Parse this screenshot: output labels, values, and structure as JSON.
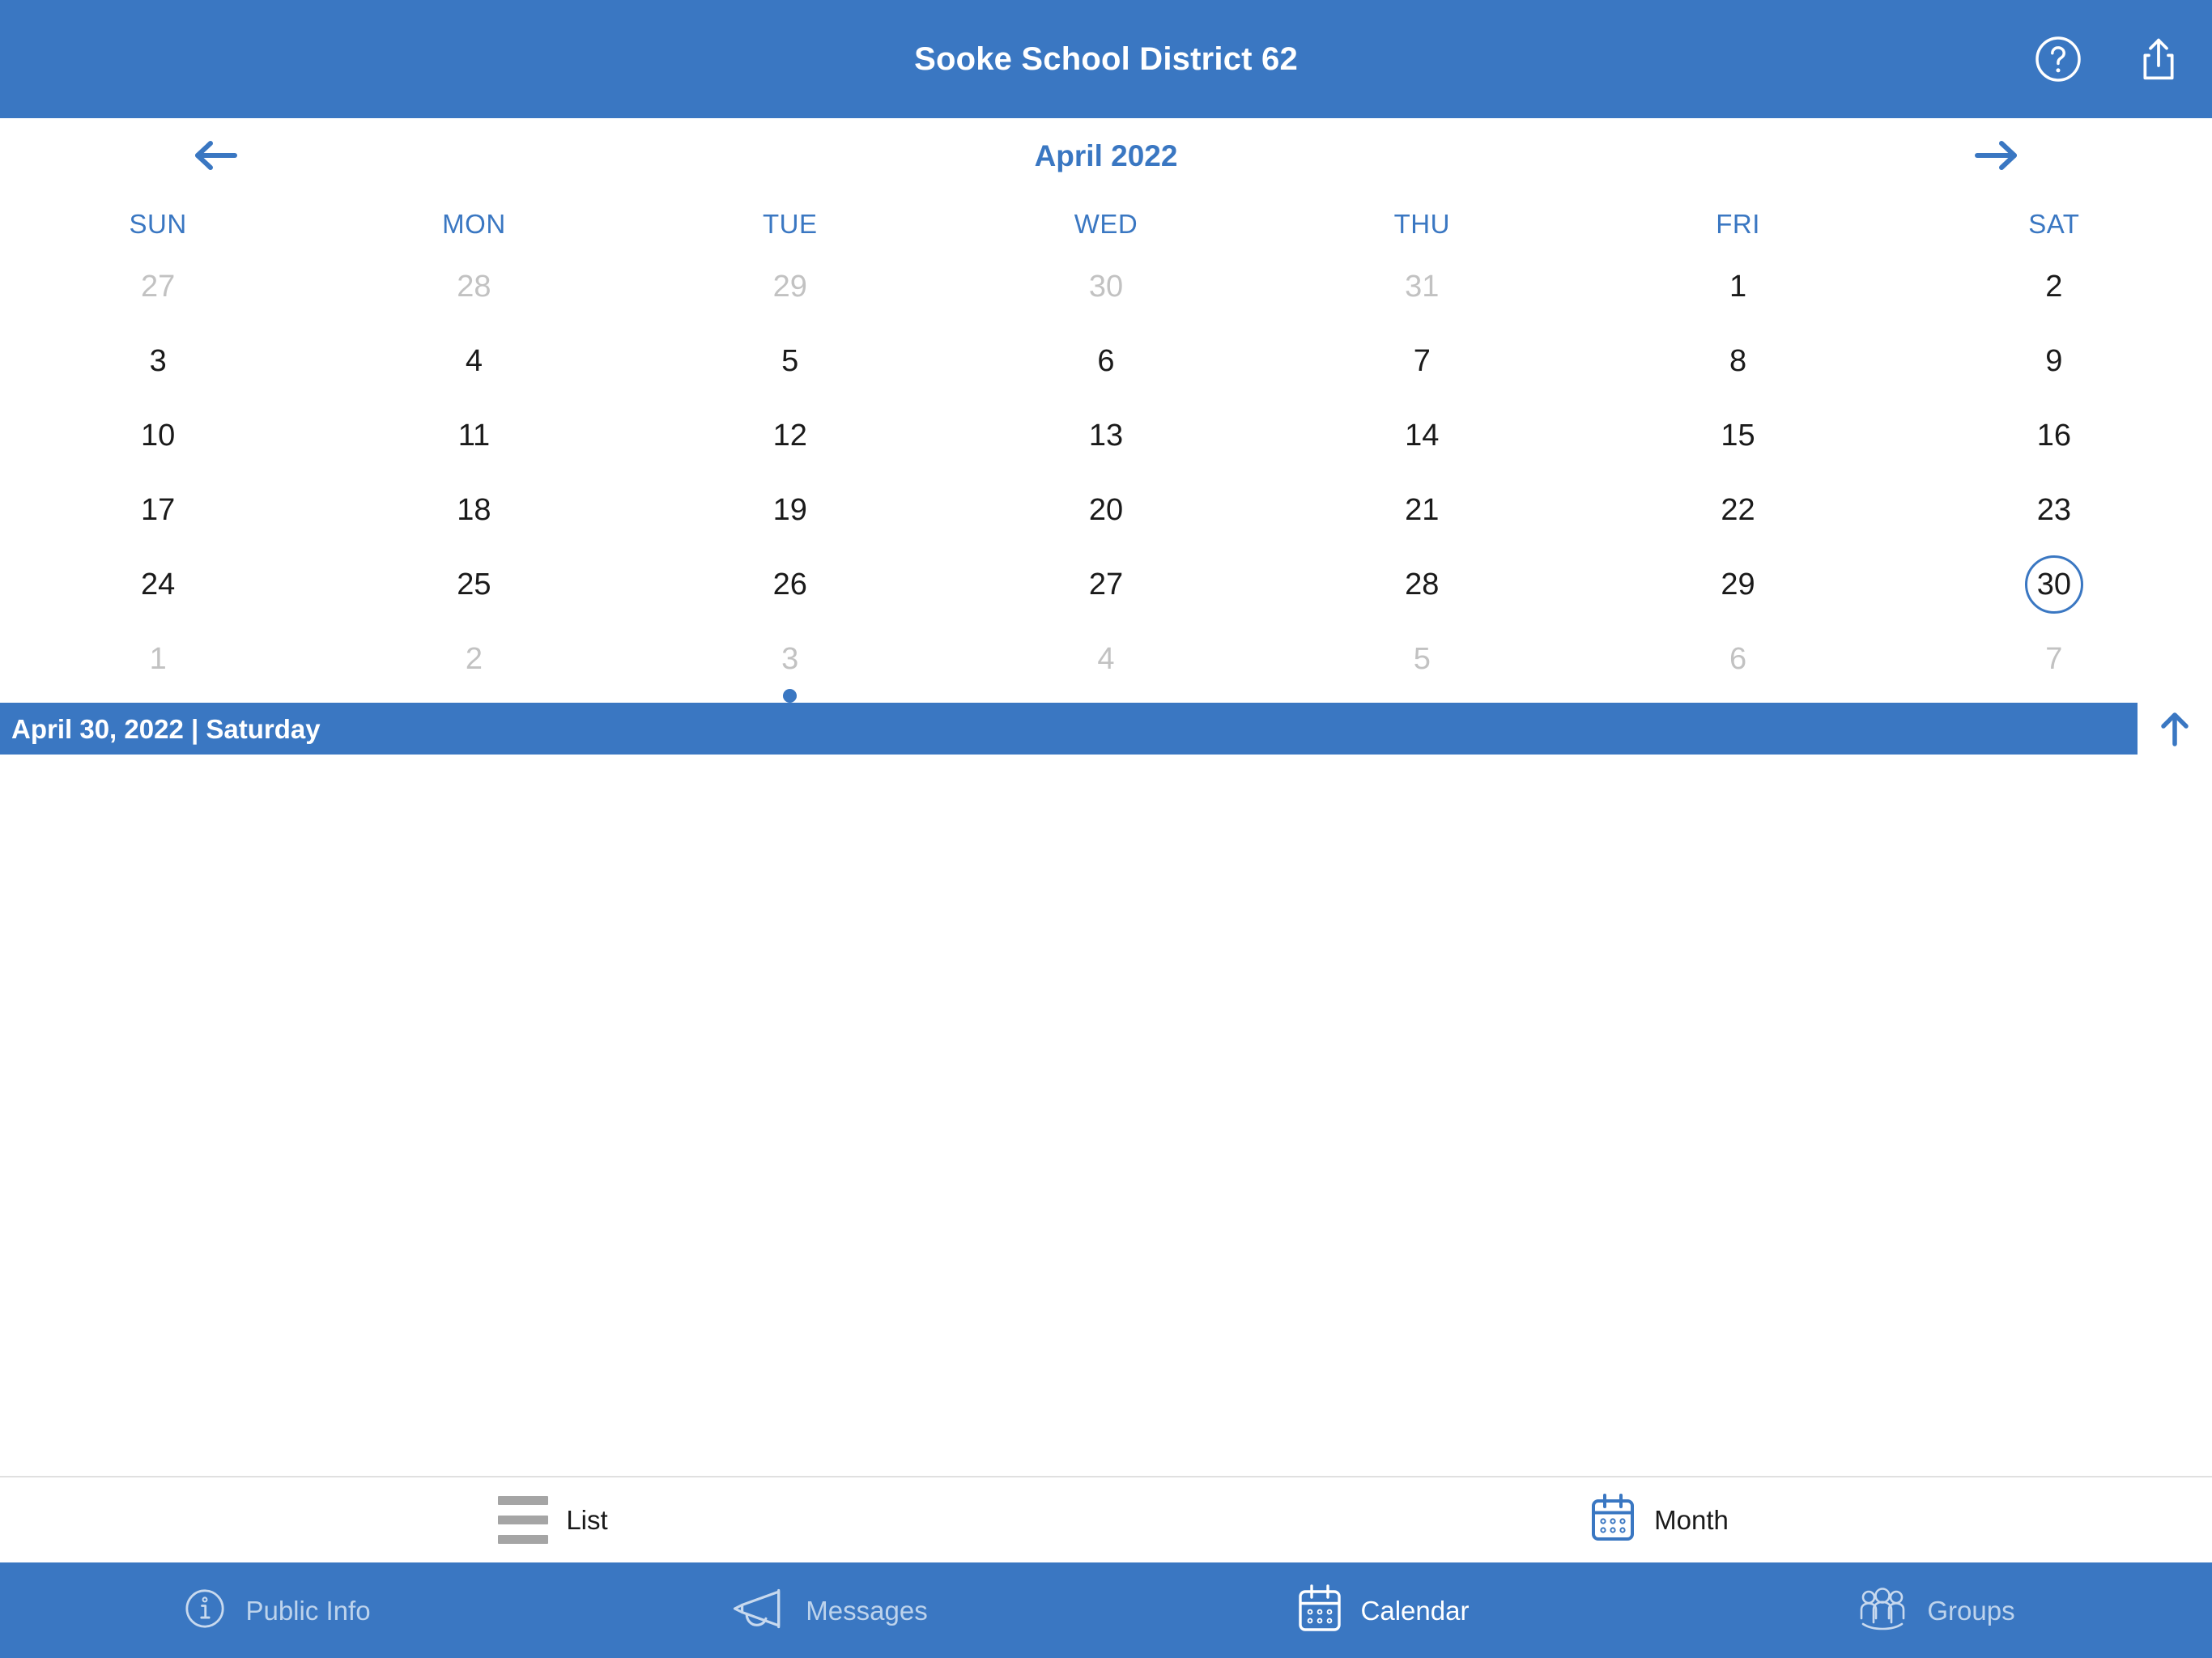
{
  "topbar": {
    "title": "Sooke School District 62",
    "help_icon": "help-circle-icon",
    "share_icon": "share-icon"
  },
  "calendar": {
    "month_title": "April 2022",
    "prev_icon": "arrow-left-icon",
    "next_icon": "arrow-right-icon",
    "weekdays": [
      "SUN",
      "MON",
      "TUE",
      "WED",
      "THU",
      "FRI",
      "SAT"
    ],
    "weeks": [
      [
        {
          "day": "27",
          "muted": true,
          "selected": false,
          "dot": false
        },
        {
          "day": "28",
          "muted": true,
          "selected": false,
          "dot": false
        },
        {
          "day": "29",
          "muted": true,
          "selected": false,
          "dot": false
        },
        {
          "day": "30",
          "muted": true,
          "selected": false,
          "dot": false
        },
        {
          "day": "31",
          "muted": true,
          "selected": false,
          "dot": false
        },
        {
          "day": "1",
          "muted": false,
          "selected": false,
          "dot": false
        },
        {
          "day": "2",
          "muted": false,
          "selected": false,
          "dot": false
        }
      ],
      [
        {
          "day": "3",
          "muted": false,
          "selected": false,
          "dot": false
        },
        {
          "day": "4",
          "muted": false,
          "selected": false,
          "dot": false
        },
        {
          "day": "5",
          "muted": false,
          "selected": false,
          "dot": false
        },
        {
          "day": "6",
          "muted": false,
          "selected": false,
          "dot": false
        },
        {
          "day": "7",
          "muted": false,
          "selected": false,
          "dot": false
        },
        {
          "day": "8",
          "muted": false,
          "selected": false,
          "dot": false
        },
        {
          "day": "9",
          "muted": false,
          "selected": false,
          "dot": false
        }
      ],
      [
        {
          "day": "10",
          "muted": false,
          "selected": false,
          "dot": false
        },
        {
          "day": "11",
          "muted": false,
          "selected": false,
          "dot": false
        },
        {
          "day": "12",
          "muted": false,
          "selected": false,
          "dot": false
        },
        {
          "day": "13",
          "muted": false,
          "selected": false,
          "dot": false
        },
        {
          "day": "14",
          "muted": false,
          "selected": false,
          "dot": false
        },
        {
          "day": "15",
          "muted": false,
          "selected": false,
          "dot": false
        },
        {
          "day": "16",
          "muted": false,
          "selected": false,
          "dot": false
        }
      ],
      [
        {
          "day": "17",
          "muted": false,
          "selected": false,
          "dot": false
        },
        {
          "day": "18",
          "muted": false,
          "selected": false,
          "dot": false
        },
        {
          "day": "19",
          "muted": false,
          "selected": false,
          "dot": false
        },
        {
          "day": "20",
          "muted": false,
          "selected": false,
          "dot": false
        },
        {
          "day": "21",
          "muted": false,
          "selected": false,
          "dot": false
        },
        {
          "day": "22",
          "muted": false,
          "selected": false,
          "dot": false
        },
        {
          "day": "23",
          "muted": false,
          "selected": false,
          "dot": false
        }
      ],
      [
        {
          "day": "24",
          "muted": false,
          "selected": false,
          "dot": false
        },
        {
          "day": "25",
          "muted": false,
          "selected": false,
          "dot": false
        },
        {
          "day": "26",
          "muted": false,
          "selected": false,
          "dot": false
        },
        {
          "day": "27",
          "muted": false,
          "selected": false,
          "dot": false
        },
        {
          "day": "28",
          "muted": false,
          "selected": false,
          "dot": false
        },
        {
          "day": "29",
          "muted": false,
          "selected": false,
          "dot": false
        },
        {
          "day": "30",
          "muted": false,
          "selected": true,
          "dot": false
        }
      ],
      [
        {
          "day": "1",
          "muted": true,
          "selected": false,
          "dot": false
        },
        {
          "day": "2",
          "muted": true,
          "selected": false,
          "dot": false
        },
        {
          "day": "3",
          "muted": true,
          "selected": false,
          "dot": true
        },
        {
          "day": "4",
          "muted": true,
          "selected": false,
          "dot": false
        },
        {
          "day": "5",
          "muted": true,
          "selected": false,
          "dot": false
        },
        {
          "day": "6",
          "muted": true,
          "selected": false,
          "dot": false
        },
        {
          "day": "7",
          "muted": true,
          "selected": false,
          "dot": false
        }
      ]
    ]
  },
  "selected_day_bar": {
    "label": "April 30, 2022 | Saturday",
    "toggle_icon": "arrow-up-icon"
  },
  "view_switcher": {
    "options": [
      {
        "label": "List",
        "icon": "list-icon",
        "active": false
      },
      {
        "label": "Month",
        "icon": "calendar-icon",
        "active": true
      }
    ]
  },
  "tabbar": {
    "tabs": [
      {
        "label": "Public Info",
        "icon": "info-circle-icon",
        "active": false
      },
      {
        "label": "Messages",
        "icon": "megaphone-icon",
        "active": false
      },
      {
        "label": "Calendar",
        "icon": "calendar-icon",
        "active": true
      },
      {
        "label": "Groups",
        "icon": "people-icon",
        "active": false
      }
    ]
  },
  "colors": {
    "brand_blue": "#3a77c2",
    "muted_day": "#c2c2c2",
    "day_text": "#1a1a1a",
    "inactive_tab": "#bdd3ec",
    "list_icon_gray": "#a5a5a5"
  }
}
